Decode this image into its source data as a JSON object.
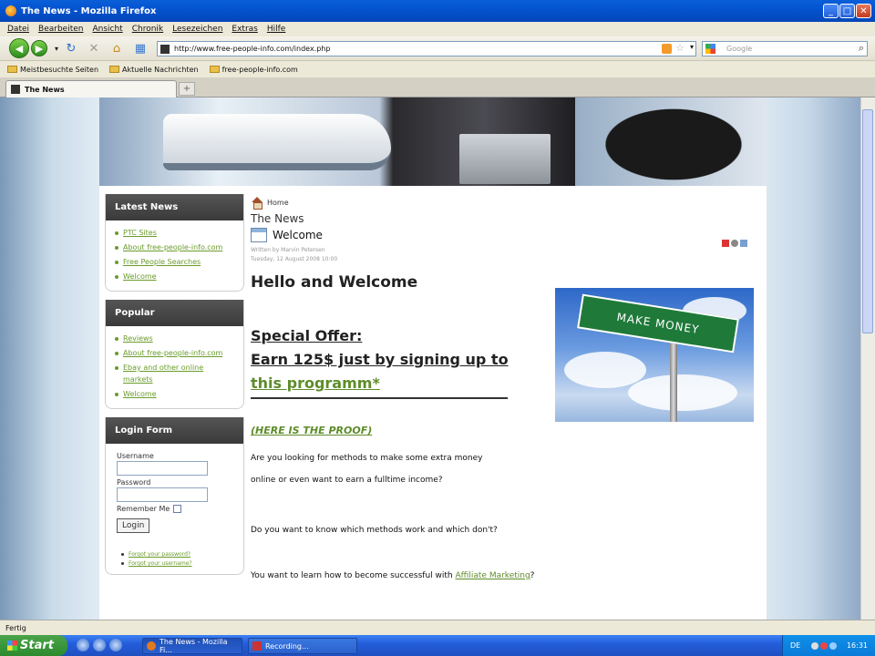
{
  "window": {
    "title": "The News - Mozilla Firefox"
  },
  "menu": [
    "Datei",
    "Bearbeiten",
    "Ansicht",
    "Chronik",
    "Lesezeichen",
    "Extras",
    "Hilfe"
  ],
  "navbar": {
    "url": "http://www.free-people-info.com/index.php",
    "search_placeholder": "Google"
  },
  "bookmarks": [
    "Meistbesuchte Seiten",
    "Aktuelle Nachrichten",
    "free-people-info.com"
  ],
  "tab": {
    "title": "The News",
    "add_label": "+"
  },
  "sidebar": {
    "latest": {
      "title": "Latest News",
      "items": [
        "PTC Sites",
        "About free-people-info.com",
        "Free People Searches",
        "Welcome"
      ]
    },
    "popular": {
      "title": "Popular",
      "items": [
        "Reviews",
        "About free-people-info.com",
        "Ebay and other online markets",
        "Welcome"
      ]
    },
    "login": {
      "title": "Login Form",
      "username_label": "Username",
      "password_label": "Password",
      "remember_label": "Remember Me",
      "button": "Login",
      "links": [
        "Forgot your password?",
        "Forgot your username?"
      ]
    }
  },
  "content": {
    "breadcrumb": "Home",
    "site_name": "The News",
    "article_title": "Welcome",
    "author": "Written by Marvin Petersen",
    "date": "Tuesday, 12 August 2008 10:00",
    "heading": "Hello and Welcome",
    "offer_line1": "Special Offer:",
    "offer_line2": "Earn 125$ just by signing up to",
    "offer_link": "this programm*",
    "proof_link": "(HERE IS THE PROOF)",
    "para1_a": "Are you looking for methods to make some extra money",
    "para1_b": "online or even want to earn a fulltime income?",
    "para2": "Do you want to know which methods work and which don't?",
    "para3_text": "You want to learn how to become successful with",
    "para3_link": "Affiliate Marketing",
    "para3_end": "?",
    "image_sign": "MAKE MONEY"
  },
  "statusbar": {
    "text": "Fertig"
  },
  "taskbar": {
    "start": "Start",
    "tasks": [
      "The News - Mozilla Fi...",
      "Recording..."
    ],
    "tray_lang": "DE",
    "tray_time": "16:31"
  },
  "colors": {
    "accent_green": "#5e8c2a",
    "module_header": "#3a3a3a",
    "xp_blue": "#245edb"
  }
}
